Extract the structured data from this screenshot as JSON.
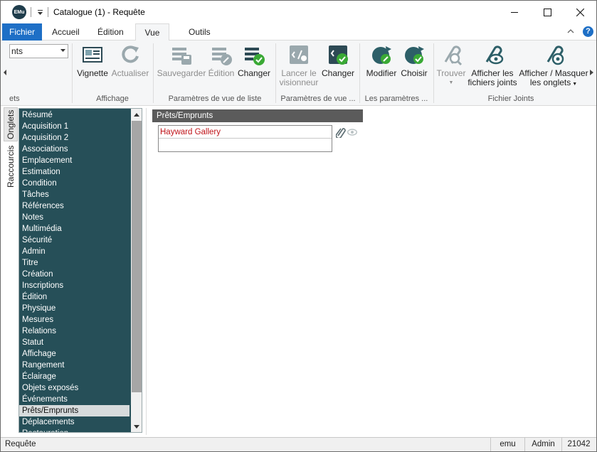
{
  "titlebar": {
    "app_logo": "EMu",
    "title": "Catalogue (1) - Requête"
  },
  "ribbon_tabs": {
    "fichier": "Fichier",
    "accueil": "Accueil",
    "edition": "Édition",
    "vue": "Vue",
    "outils": "Outils",
    "help": "?"
  },
  "ribbon": {
    "combo_value": "nts",
    "group_left_label": "ets",
    "vignette": "Vignette",
    "actualiser": "Actualiser",
    "affichage_label": "Affichage",
    "sauvegarder": "Sauvegarder",
    "edition": "Édition",
    "changer1": "Changer",
    "liste_label": "Paramètres de vue de liste",
    "lancer_line1": "Lancer le",
    "lancer_line2": "visionneur",
    "changer2": "Changer",
    "vue_label": "Paramètres de vue ...",
    "modifier": "Modifier",
    "choisir": "Choisir",
    "params_label": "Les paramètres ...",
    "trouver": "Trouver",
    "afficher_line1": "Afficher les",
    "afficher_line2": "fichiers joints",
    "masquer_line1": "Afficher / Masquer",
    "masquer_line2": "les onglets",
    "fichiers_label": "Fichier Joints"
  },
  "side_tabs": {
    "onglets": "Onglets",
    "raccourcis": "Raccourcis"
  },
  "tab_list": {
    "items": [
      "Résumé",
      "Acquisition 1",
      "Acquisition 2",
      "Associations",
      "Emplacement",
      "Estimation",
      "Condition",
      "Tâches",
      "Références",
      "Notes",
      "Multimédia",
      "Sécurité",
      "Admin",
      "Titre",
      "Création",
      "Inscriptions",
      "Édition",
      "Physique",
      "Mesures",
      "Relations",
      "Statut",
      "Affichage",
      "Rangement",
      "Éclairage",
      "Objets exposés",
      "Événements",
      "Prêts/Emprunts",
      "Déplacements",
      "Restauration"
    ],
    "selected": "Prêts/Emprunts"
  },
  "content": {
    "section_title": "Prêts/Emprunts",
    "loan_value": "Hayward Gallery"
  },
  "statusbar": {
    "mode": "Requête",
    "user": "emu",
    "group": "Admin",
    "count": "21042"
  },
  "colors": {
    "accent_blue": "#1e6fc6",
    "tablist_bg": "#264f58",
    "loan_text": "#c0141a",
    "teal_icon": "#2d5f68",
    "green_check": "#3aa935"
  }
}
